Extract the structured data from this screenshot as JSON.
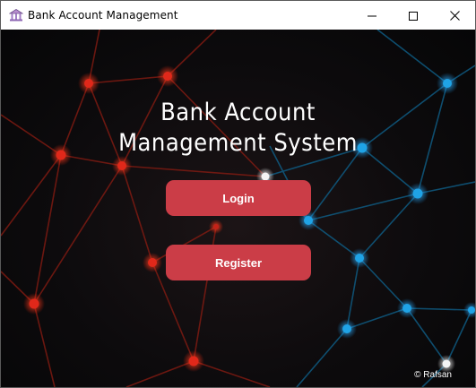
{
  "window": {
    "title": "Bank Account Management",
    "controls": {
      "minimize": "minimize-icon",
      "maximize": "maximize-icon",
      "close": "close-icon"
    }
  },
  "app": {
    "heading_line1": "Bank Account",
    "heading_line2": "Management System",
    "login_label": "Login",
    "register_label": "Register",
    "credit": "© Rafsan"
  },
  "colors": {
    "button": "#cb3d47",
    "text": "#ffffff",
    "network_red": "#e0281a",
    "network_blue": "#1fa3e6",
    "background": "#0a0a0c"
  }
}
